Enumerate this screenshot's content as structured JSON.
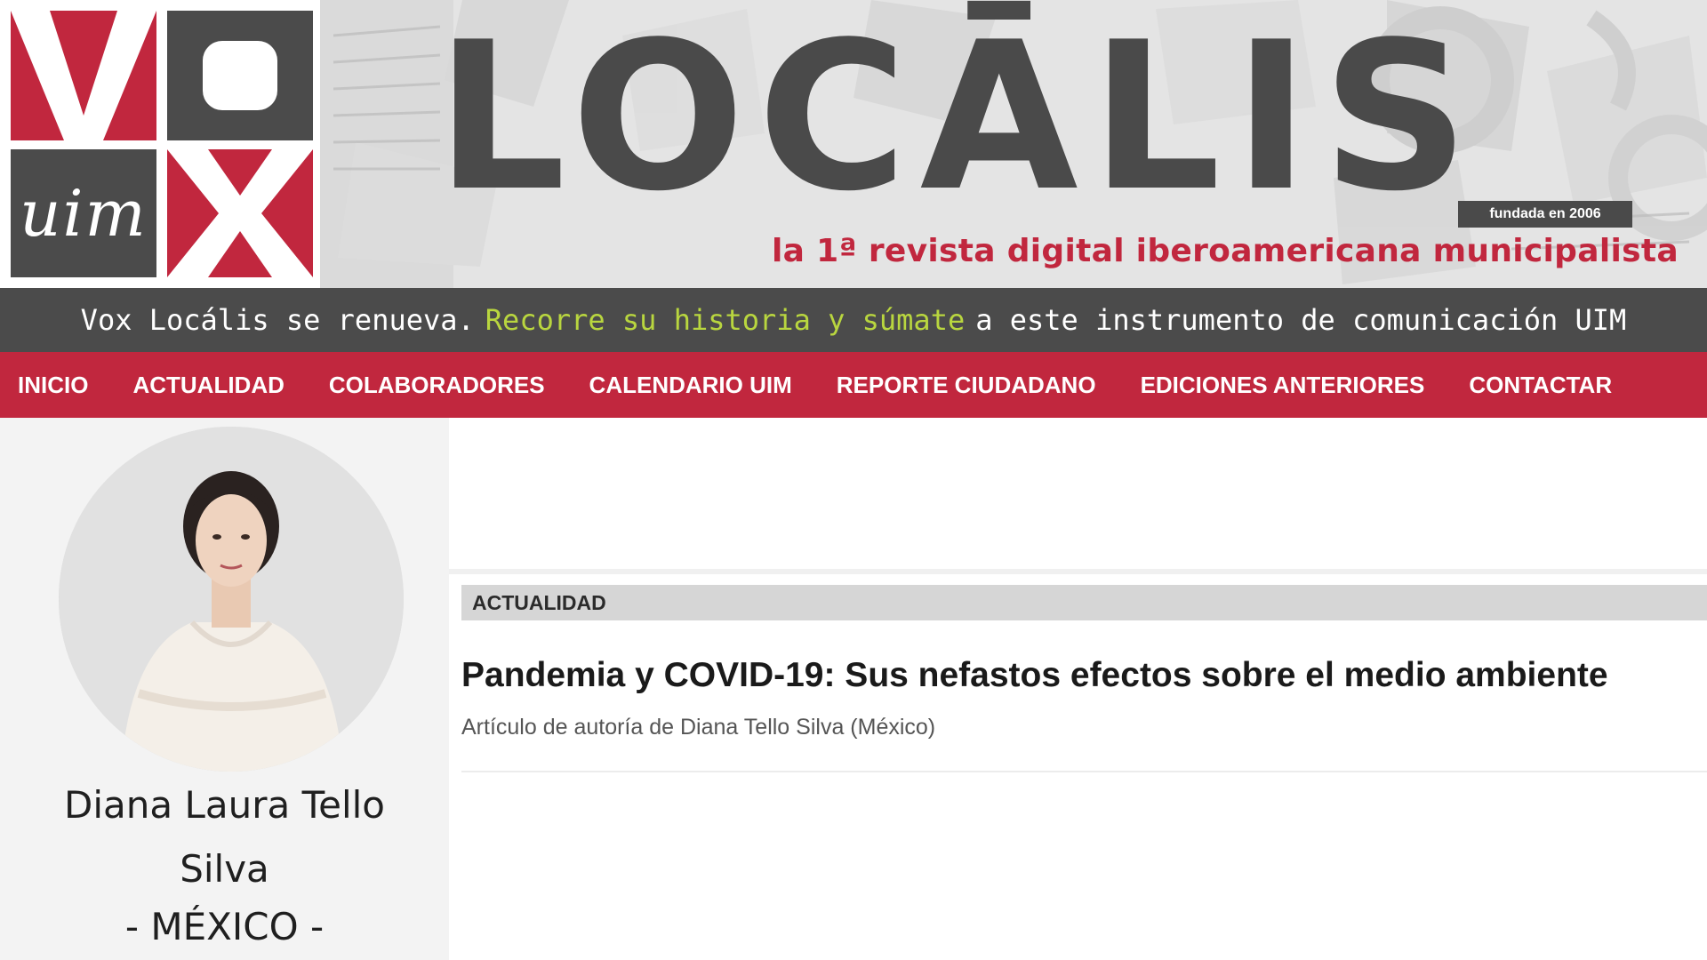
{
  "masthead": {
    "logo": {
      "letters": [
        "V",
        "O",
        "X"
      ],
      "uim": "uim"
    },
    "title": "LOCĀLIS",
    "founded": "fundada en 2006",
    "tagline": "la 1ª revista digital iberoamericana municipalista"
  },
  "announcement": {
    "part1": "Vox Locális se renueva.",
    "highlight": "Recorre su historia y súmate",
    "part2": "a este instrumento de comunicación UIM"
  },
  "nav": {
    "items": [
      {
        "label": "INICIO"
      },
      {
        "label": "ACTUALIDAD"
      },
      {
        "label": "COLABORADORES"
      },
      {
        "label": "CALENDARIO UIM"
      },
      {
        "label": "REPORTE CIUDADANO"
      },
      {
        "label": "EDICIONES ANTERIORES"
      },
      {
        "label": "CONTACTAR"
      }
    ]
  },
  "author": {
    "name_line1": "Diana Laura Tello",
    "name_line2": "Silva",
    "country": "- MÉXICO -"
  },
  "article": {
    "category": "ACTUALIDAD",
    "title": "Pandemia y COVID-19: Sus nefastos efectos sobre el medio ambiente",
    "byline": "Artículo de autoría de Diana Tello Silva (México)"
  },
  "colors": {
    "brand_red": "#c1273e",
    "dark_gray": "#4b4b4b",
    "highlight_green": "#b9d63f"
  }
}
